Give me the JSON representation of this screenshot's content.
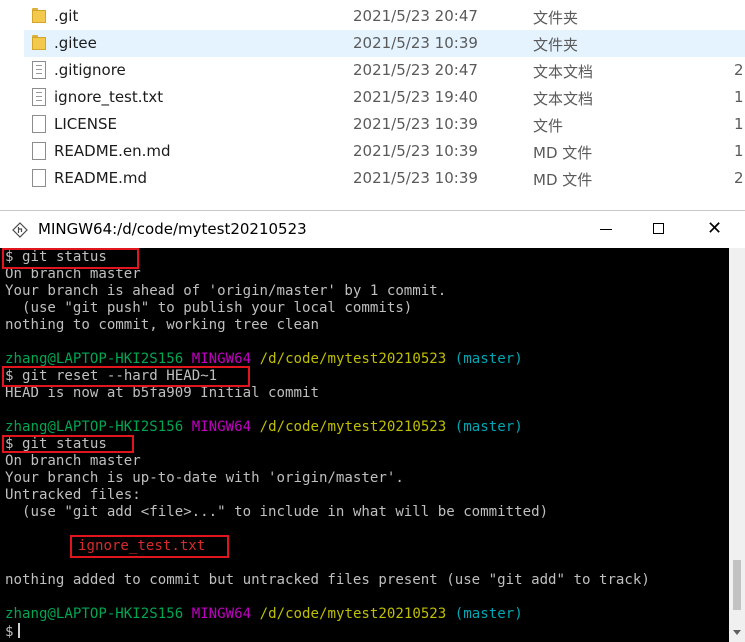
{
  "explorer": {
    "files": [
      {
        "name": ".git",
        "date": "2021/5/23 20:47",
        "type": "文件夹",
        "size": "",
        "icon": "folder-icon"
      },
      {
        "name": ".gitee",
        "date": "2021/5/23 10:39",
        "type": "文件夹",
        "size": "",
        "icon": "folder-icon",
        "selected": true
      },
      {
        "name": ".gitignore",
        "date": "2021/5/23 20:47",
        "type": "文本文档",
        "size": "2",
        "icon": "text-file-icon"
      },
      {
        "name": "ignore_test.txt",
        "date": "2021/5/23 19:40",
        "type": "文本文档",
        "size": "1",
        "icon": "text-file-icon"
      },
      {
        "name": "LICENSE",
        "date": "2021/5/23 10:39",
        "type": "文件",
        "size": "1",
        "icon": "file-icon"
      },
      {
        "name": "README.en.md",
        "date": "2021/5/23 10:39",
        "type": "MD 文件",
        "size": "1",
        "icon": "file-icon"
      },
      {
        "name": "README.md",
        "date": "2021/5/23 10:39",
        "type": "MD 文件",
        "size": "2",
        "icon": "file-icon"
      }
    ]
  },
  "terminal": {
    "title": "MINGW64:/d/code/mytest20210523",
    "window_controls": {
      "minimize": "minimize-icon",
      "maximize": "maximize-icon",
      "close": "✕"
    },
    "prompt": {
      "user": "zhang@LAPTOP-HKI2S156",
      "env": "MINGW64",
      "path": "/d/code/mytest20210523",
      "branch": "(master)",
      "symbol": "$"
    },
    "lines": {
      "cmd1": "git status",
      "l1": "On branch master",
      "l2": "Your branch is ahead of 'origin/master' by 1 commit.",
      "l3": "  (use \"git push\" to publish your local commits)",
      "l4": "nothing to commit, working tree clean",
      "cmd2": "git reset --hard HEAD~1",
      "l5": "HEAD is now at b5fa909 Initial commit",
      "cmd3": "git status",
      "l6": "On branch master",
      "l7": "Your branch is up-to-date with 'origin/master'.",
      "l8": "Untracked files:",
      "l9": "  (use \"git add <file>...\" to include in what will be committed)",
      "untracked": "ignore_test.txt",
      "l10": "nothing added to commit but untracked files present (use \"git add\" to track)"
    },
    "colors": {
      "background": "#000000",
      "text": "#bfbfbf",
      "user": "#00a651",
      "env": "#c000c0",
      "path": "#bfbf00",
      "branch": "#00a6b2",
      "untracked": "#d82a2a",
      "highlight_box": "#e0151d"
    }
  }
}
